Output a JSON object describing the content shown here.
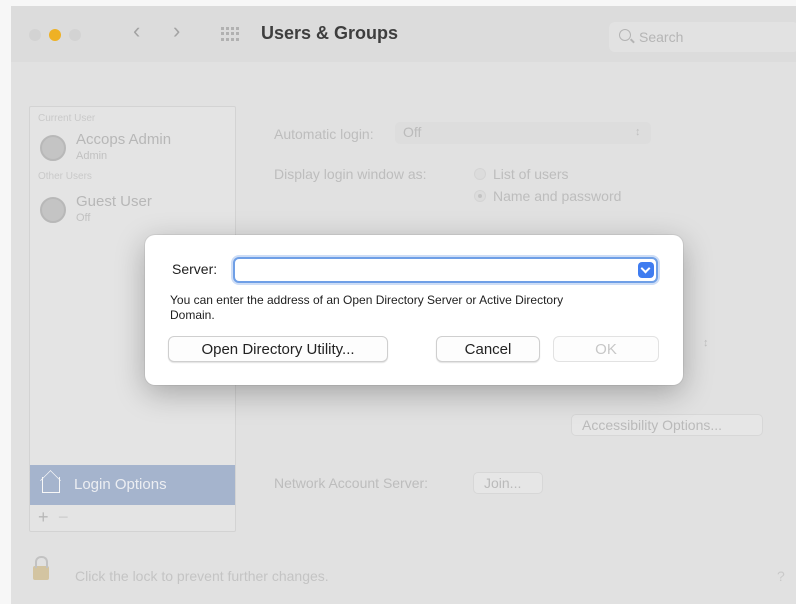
{
  "window": {
    "title": "Users & Groups",
    "search_placeholder": "Search"
  },
  "sidebar": {
    "current_user_heading": "Current User",
    "other_users_heading": "Other Users",
    "users": [
      {
        "name": "Accops Admin",
        "role": "Admin"
      },
      {
        "name": "Guest User",
        "role": "Off"
      }
    ],
    "login_options_label": "Login Options",
    "add_label": "+",
    "remove_label": "−"
  },
  "main": {
    "automatic_login_label": "Automatic login:",
    "automatic_login_value": "Off",
    "display_login_label": "Display login window as:",
    "display_options": [
      "List of users",
      "Name and password"
    ],
    "selected_display_option": 1,
    "accessibility_button": "Accessibility Options...",
    "network_server_label": "Network Account Server:",
    "join_button": "Join..."
  },
  "footer": {
    "lock_text": "Click the lock to prevent further changes.",
    "help_label": "?"
  },
  "dialog": {
    "server_label": "Server:",
    "server_value": "",
    "help_text": "You can enter the address of an Open Directory Server or Active Directory Domain.",
    "open_directory_button": "Open Directory Utility...",
    "cancel_button": "Cancel",
    "ok_button": "OK"
  },
  "colors": {
    "accent": "#3f7cf0",
    "focus_ring": "#6f9fe6",
    "close_light": "#d8d8d8",
    "minimize_light": "#f6b51f",
    "selection_bg": "#a8b8d3"
  },
  "icons": [
    "chevron-left-icon",
    "chevron-right-icon",
    "grid-icon",
    "search-icon",
    "user-avatar-icon",
    "home-icon",
    "lock-icon",
    "dropdown-chevron-icon"
  ]
}
